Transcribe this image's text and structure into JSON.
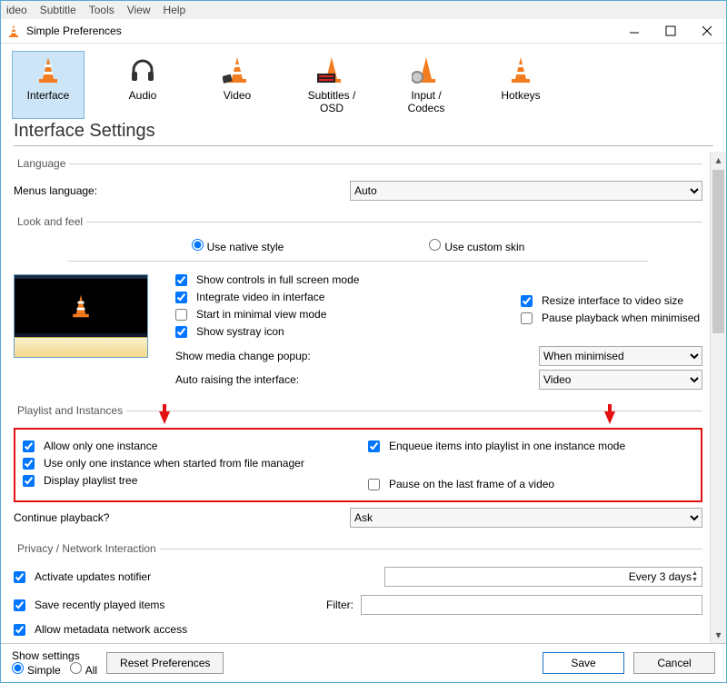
{
  "menubar": {
    "items": [
      "ideo",
      "Subtitle",
      "Tools",
      "View",
      "Help"
    ]
  },
  "window": {
    "title": "Simple Preferences"
  },
  "tabs": {
    "items": [
      {
        "label": "Interface",
        "selected": true
      },
      {
        "label": "Audio"
      },
      {
        "label": "Video"
      },
      {
        "label": "Subtitles / OSD"
      },
      {
        "label": "Input / Codecs"
      },
      {
        "label": "Hotkeys"
      }
    ]
  },
  "page": {
    "heading": "Interface Settings"
  },
  "language": {
    "legend": "Language",
    "menus_label": "Menus language:",
    "value": "Auto"
  },
  "look": {
    "legend": "Look and feel",
    "native": "Use native style",
    "custom": "Use custom skin",
    "chk_fullscreen": "Show controls in full screen mode",
    "chk_integrate": "Integrate video in interface",
    "chk_minimal": "Start in minimal view mode",
    "chk_systray": "Show systray icon",
    "chk_resize": "Resize interface to video size",
    "chk_pause_min": "Pause playback when minimised",
    "popup_label": "Show media change popup:",
    "popup_value": "When minimised",
    "raise_label": "Auto raising the interface:",
    "raise_value": "Video"
  },
  "playlist": {
    "legend": "Playlist and Instances",
    "chk_one_instance": "Allow only one instance",
    "chk_one_filemgr": "Use only one instance when started from file manager",
    "chk_tree": "Display playlist tree",
    "chk_enqueue": "Enqueue items into playlist in one instance mode",
    "chk_pause_last": "Pause on the last frame of a video",
    "continue_label": "Continue playback?",
    "continue_value": "Ask"
  },
  "privacy": {
    "legend": "Privacy / Network Interaction",
    "chk_updates": "Activate updates notifier",
    "updates_interval": "Every 3 days",
    "chk_recent": "Save recently played items",
    "filter_label": "Filter:",
    "chk_metadata": "Allow metadata network access"
  },
  "footer": {
    "show_settings": "Show settings",
    "simple": "Simple",
    "all": "All",
    "reset": "Reset Preferences",
    "save": "Save",
    "cancel": "Cancel"
  }
}
